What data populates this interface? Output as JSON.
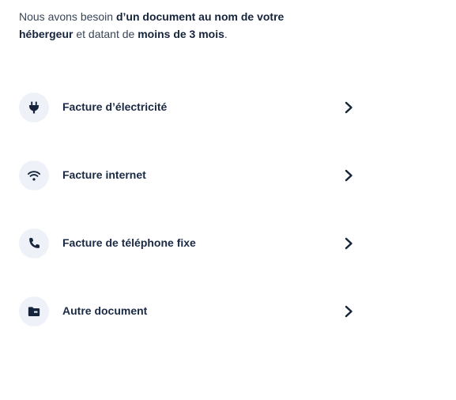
{
  "intro": {
    "part1": "Nous avons besoin ",
    "bold1": "d’un document au nom de votre hébergeur",
    "part2": " et datant de ",
    "bold2": "moins de 3 mois",
    "part3": "."
  },
  "options": [
    {
      "label": "Facture d’électricité",
      "icon": "plug-icon"
    },
    {
      "label": "Facture internet",
      "icon": "wifi-icon"
    },
    {
      "label": "Facture de téléphone fixe",
      "icon": "phone-icon"
    },
    {
      "label": "Autre document",
      "icon": "folder-icon"
    }
  ],
  "colors": {
    "text": "#1a2a44",
    "icon_bg": "#eef2f8",
    "icon_fg": "#16243b"
  }
}
